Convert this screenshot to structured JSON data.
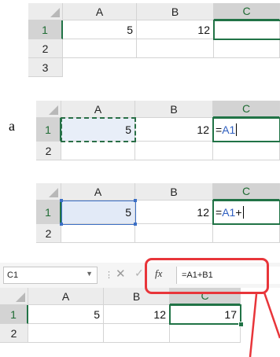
{
  "step_label": "a",
  "panel1": {
    "columns": [
      "A",
      "B",
      "C"
    ],
    "rows": [
      "1",
      "2",
      "3"
    ],
    "cells": {
      "a1": "5",
      "b1": "12",
      "c1": ""
    }
  },
  "panel2": {
    "columns": [
      "A",
      "B",
      "C"
    ],
    "rows": [
      "1",
      "2"
    ],
    "cells": {
      "a1": "5",
      "b1": "12"
    },
    "formula_prefix": "=",
    "formula_ref": "A1"
  },
  "panel3": {
    "columns": [
      "A",
      "B",
      "C"
    ],
    "rows": [
      "1",
      "2"
    ],
    "cells": {
      "a1": "5",
      "b1": "12"
    },
    "formula_prefix": "=",
    "formula_ref": "A1",
    "formula_suffix": "+"
  },
  "panel4": {
    "name_box": "C1",
    "cancel_symbol": "✕",
    "enter_symbol": "✓",
    "fx_label": "fx",
    "formula_bar": "=A1+B1",
    "columns": [
      "A",
      "B",
      "C"
    ],
    "rows": [
      "1",
      "2"
    ],
    "cells": {
      "a1": "5",
      "b1": "12",
      "c1": "17"
    }
  },
  "colors": {
    "excel_green": "#217346",
    "reference_blue": "#3b6fc6",
    "callout_red": "#e8353a"
  }
}
